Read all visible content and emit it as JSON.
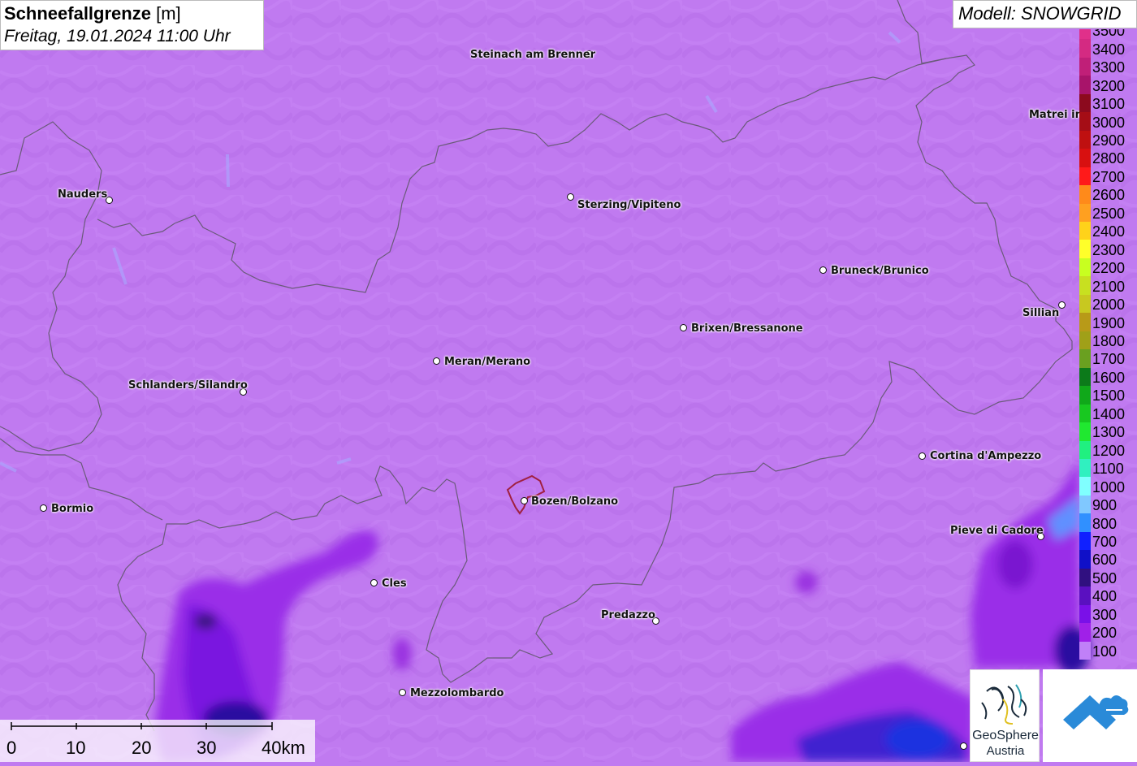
{
  "header": {
    "title_bold": "Schneefallgrenze",
    "title_unit": "[m]",
    "datetime": "Freitag, 19.01.2024 11:00 Uhr"
  },
  "model_label": "Modell: SNOWGRID",
  "cities": [
    {
      "name": "Steinach am Brenner"
    },
    {
      "name": "Nauders"
    },
    {
      "name": "Sterzing/Vipiteno"
    },
    {
      "name": "Matrei in"
    },
    {
      "name": "Bruneck/Brunico"
    },
    {
      "name": "Sillian"
    },
    {
      "name": "Brixen/Bressanone"
    },
    {
      "name": "Meran/Merano"
    },
    {
      "name": "Schlanders/Silandro"
    },
    {
      "name": "Cortina d'Ampezzo"
    },
    {
      "name": "Bormio"
    },
    {
      "name": "Bozen/Bolzano"
    },
    {
      "name": "Pieve di Cadore"
    },
    {
      "name": "Cles"
    },
    {
      "name": "Predazzo"
    },
    {
      "name": "Mezzolombardo"
    }
  ],
  "legend": {
    "levels": [
      {
        "label": "3500",
        "color": "#e0308a"
      },
      {
        "label": "3400",
        "color": "#d42a82"
      },
      {
        "label": "3300",
        "color": "#c01f78"
      },
      {
        "label": "3200",
        "color": "#a8146a"
      },
      {
        "label": "3100",
        "color": "#8c0a1e"
      },
      {
        "label": "3000",
        "color": "#a50d16"
      },
      {
        "label": "2900",
        "color": "#bf1010"
      },
      {
        "label": "2800",
        "color": "#d81010"
      },
      {
        "label": "2700",
        "color": "#ff1a1a"
      },
      {
        "label": "2600",
        "color": "#ff8a1a"
      },
      {
        "label": "2500",
        "color": "#ffa020"
      },
      {
        "label": "2400",
        "color": "#ffd21a"
      },
      {
        "label": "2300",
        "color": "#ffff2a"
      },
      {
        "label": "2200",
        "color": "#c8ff20"
      },
      {
        "label": "2100",
        "color": "#c8e020"
      },
      {
        "label": "2000",
        "color": "#c8c820"
      },
      {
        "label": "1900",
        "color": "#b89a18"
      },
      {
        "label": "1800",
        "color": "#a0a018"
      },
      {
        "label": "1700",
        "color": "#6aa020"
      },
      {
        "label": "1600",
        "color": "#0c7a1a"
      },
      {
        "label": "1500",
        "color": "#10a81a"
      },
      {
        "label": "1400",
        "color": "#18c820"
      },
      {
        "label": "1300",
        "color": "#20e830"
      },
      {
        "label": "1200",
        "color": "#20f080"
      },
      {
        "label": "1100",
        "color": "#30f0c0"
      },
      {
        "label": "1000",
        "color": "#80ffff"
      },
      {
        "label": "900",
        "color": "#80c8ff"
      },
      {
        "label": "800",
        "color": "#3090ff"
      },
      {
        "label": "700",
        "color": "#1020ff"
      },
      {
        "label": "600",
        "color": "#1010c8"
      },
      {
        "label": "500",
        "color": "#301080"
      },
      {
        "label": "400",
        "color": "#5a10c0"
      },
      {
        "label": "300",
        "color": "#7a10e8"
      },
      {
        "label": "200",
        "color": "#a020e8"
      },
      {
        "label": "100",
        "color": "#c080f8"
      }
    ]
  },
  "scale_bar": {
    "labels": [
      "0",
      "10",
      "20",
      "30",
      "40km"
    ]
  },
  "logos": {
    "geosphere_line1": "GeoSphere",
    "geosphere_line2": "Austria"
  },
  "colors": {
    "map_base": "#c07af0",
    "border": "#6a5a7a",
    "bozen_boundary": "#a02040"
  }
}
